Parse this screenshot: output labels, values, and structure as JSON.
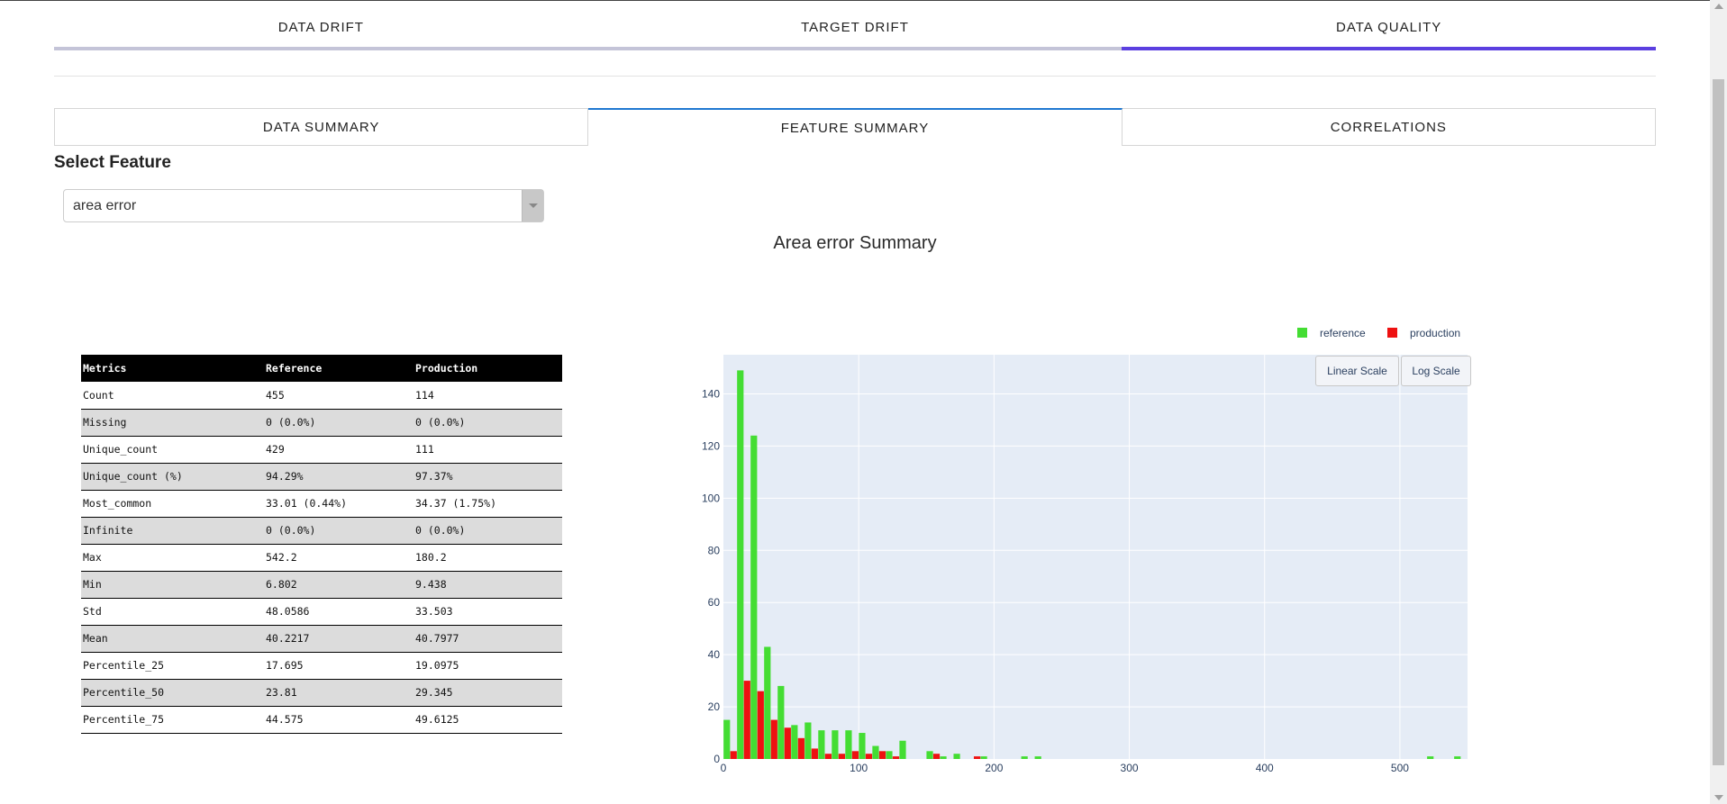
{
  "main_tabs": [
    {
      "label": "DATA DRIFT",
      "active": false
    },
    {
      "label": "TARGET DRIFT",
      "active": false
    },
    {
      "label": "DATA QUALITY",
      "active": true
    }
  ],
  "sub_tabs": [
    {
      "label": "DATA SUMMARY",
      "active": false
    },
    {
      "label": "FEATURE SUMMARY",
      "active": true
    },
    {
      "label": "CORRELATIONS",
      "active": false
    }
  ],
  "select_feature": {
    "label": "Select Feature",
    "value": "area error"
  },
  "summary_title": "Area error Summary",
  "metrics_table": {
    "headers": [
      "Metrics",
      "Reference",
      "Production"
    ],
    "rows": [
      [
        "Count",
        "455",
        "114"
      ],
      [
        "Missing",
        "0 (0.0%)",
        "0 (0.0%)"
      ],
      [
        "Unique_count",
        "429",
        "111"
      ],
      [
        "Unique_count (%)",
        "94.29%",
        "97.37%"
      ],
      [
        "Most_common",
        "33.01 (0.44%)",
        "34.37 (1.75%)"
      ],
      [
        "Infinite",
        "0 (0.0%)",
        "0 (0.0%)"
      ],
      [
        "Max",
        "542.2",
        "180.2"
      ],
      [
        "Min",
        "6.802",
        "9.438"
      ],
      [
        "Std",
        "48.0586",
        "33.503"
      ],
      [
        "Mean",
        "40.2217",
        "40.7977"
      ],
      [
        "Percentile_25",
        "17.695",
        "19.0975"
      ],
      [
        "Percentile_50",
        "23.81",
        "29.345"
      ],
      [
        "Percentile_75",
        "44.575",
        "49.6125"
      ]
    ]
  },
  "scale_buttons": {
    "linear": "Linear Scale",
    "log": "Log Scale"
  },
  "colors": {
    "reference": "#44dd33",
    "production": "#ee1111",
    "plot_bg": "#e5ecf6",
    "accent": "#5b3fe0"
  },
  "chart_data": {
    "type": "bar",
    "bar_width": 4.8,
    "xlim": [
      0,
      550
    ],
    "ylim": [
      0,
      155
    ],
    "x_ticks": [
      0,
      100,
      200,
      300,
      400,
      500
    ],
    "y_ticks": [
      0,
      20,
      40,
      60,
      80,
      100,
      120,
      140
    ],
    "legend_position": "top-right",
    "grid": true,
    "series": [
      {
        "name": "reference",
        "color": "#44dd33",
        "points": [
          [
            2.5,
            15
          ],
          [
            12.5,
            149
          ],
          [
            22.5,
            124
          ],
          [
            32.5,
            43
          ],
          [
            42.5,
            28
          ],
          [
            52.5,
            13
          ],
          [
            62.5,
            14
          ],
          [
            72.5,
            11
          ],
          [
            82.5,
            11
          ],
          [
            92.5,
            11
          ],
          [
            102.5,
            10
          ],
          [
            112.5,
            5
          ],
          [
            122.5,
            3
          ],
          [
            132.5,
            7
          ],
          [
            152.5,
            3
          ],
          [
            162.5,
            1
          ],
          [
            172.5,
            2
          ],
          [
            192.5,
            1
          ],
          [
            222.5,
            1
          ],
          [
            232.5,
            1
          ],
          [
            522.5,
            1
          ],
          [
            542.5,
            1
          ]
        ]
      },
      {
        "name": "production",
        "color": "#ee1111",
        "points": [
          [
            7.5,
            3
          ],
          [
            17.5,
            30
          ],
          [
            27.5,
            26
          ],
          [
            37.5,
            15
          ],
          [
            47.5,
            12
          ],
          [
            57.5,
            8
          ],
          [
            67.5,
            4
          ],
          [
            77.5,
            2
          ],
          [
            87.5,
            2
          ],
          [
            97.5,
            3
          ],
          [
            107.5,
            2
          ],
          [
            117.5,
            3
          ],
          [
            127.5,
            1
          ],
          [
            157.5,
            2
          ],
          [
            187.5,
            1
          ]
        ]
      }
    ]
  }
}
